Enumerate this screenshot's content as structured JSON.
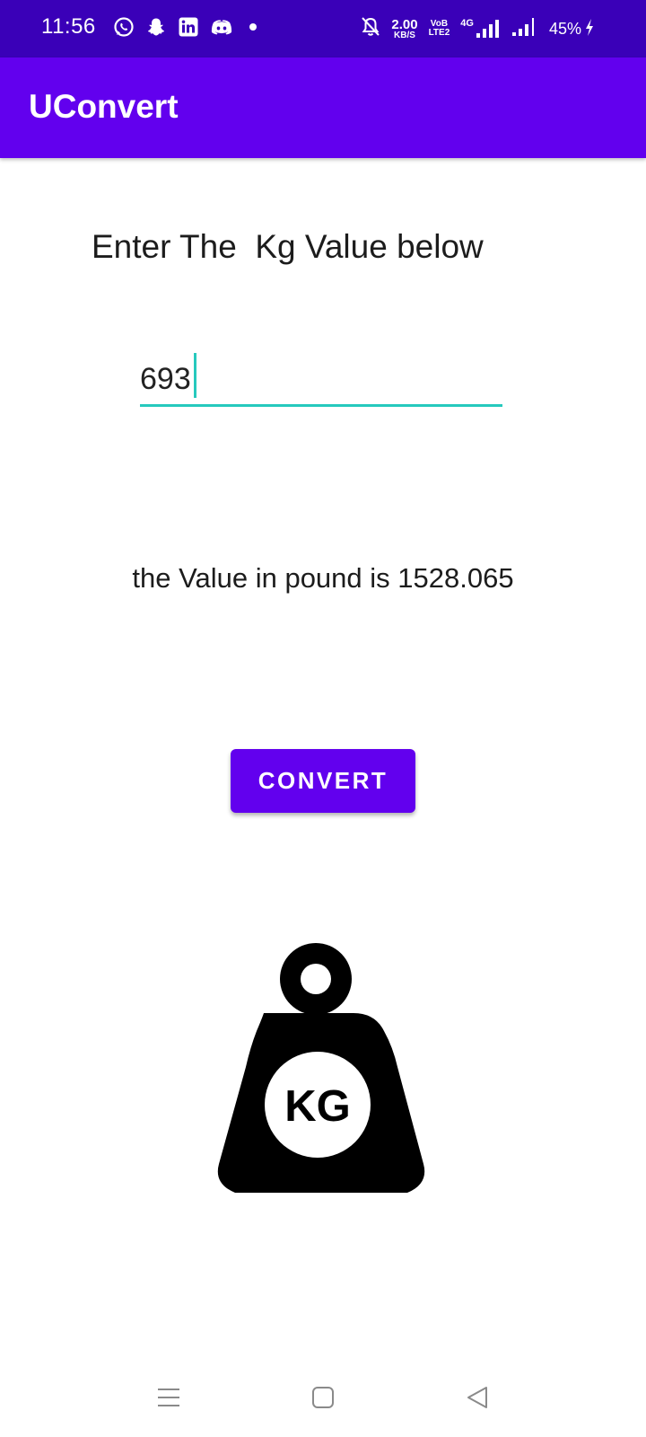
{
  "status_bar": {
    "time": "11:56",
    "net_speed_value": "2.00",
    "net_speed_unit": "KB/S",
    "volte_top": "VoB",
    "volte_bottom": "LTE2",
    "network_type": "4G",
    "battery": "45%",
    "icons_left": [
      "whatsapp-icon",
      "snapchat-icon",
      "linkedin-icon",
      "discord-icon",
      "dot-icon"
    ],
    "icons_right": [
      "mute-bell-icon",
      "signal-icon",
      "signal-icon",
      "charging-icon"
    ]
  },
  "app_bar": {
    "title": "UConvert"
  },
  "main": {
    "prompt_label": "Enter The  Kg Value below",
    "kg_input_value": "693",
    "result_text": "the Value in pound is 1528.065",
    "convert_label": "CONVERT",
    "weight_image_label": "KG"
  },
  "nav_bar": {
    "items": [
      "menu-icon",
      "home-icon",
      "back-icon"
    ]
  },
  "colors": {
    "status_bar": "#3a00b8",
    "app_bar": "#6200ee",
    "accent": "#26c9bd",
    "button": "#6200ee",
    "text": "#1c1c1c"
  }
}
